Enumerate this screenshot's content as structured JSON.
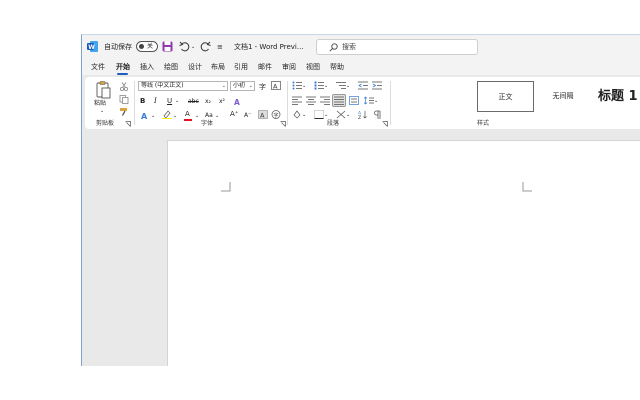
{
  "titlebar": {
    "autosave_label": "自动保存",
    "autosave_state": "关",
    "doc_title": "文档1 - Word Previ...",
    "qat_more": "≡"
  },
  "search": {
    "placeholder": "搜索"
  },
  "tabs": [
    {
      "label": "文件"
    },
    {
      "label": "开始"
    },
    {
      "label": "插入"
    },
    {
      "label": "绘图"
    },
    {
      "label": "设计"
    },
    {
      "label": "布局"
    },
    {
      "label": "引用"
    },
    {
      "label": "邮件"
    },
    {
      "label": "审阅"
    },
    {
      "label": "视图"
    },
    {
      "label": "帮助"
    }
  ],
  "active_tab": "开始",
  "ribbon": {
    "clipboard": {
      "paste_label": "粘贴",
      "group_label": "剪贴板"
    },
    "font": {
      "font_name": "等线 (中文正文)",
      "font_size": "小初",
      "bold": "B",
      "italic": "I",
      "underline": "U",
      "strike": "abc",
      "subscript": "x₂",
      "superscript": "x²",
      "font_color_letter": "A",
      "grow": "A⁺",
      "shrink": "A⁻",
      "change_case": "Aa",
      "clear_format": "A",
      "group_label": "字体"
    },
    "paragraph": {
      "group_label": "段落"
    },
    "styles": {
      "items": [
        {
          "label": "正文"
        },
        {
          "label": "无间隔"
        },
        {
          "label": "标题 1"
        }
      ],
      "group_label": "样式"
    }
  },
  "colors": {
    "accent": "#1f5fbf",
    "font_color_bar": "#e81123",
    "highlight_bar": "#fff100",
    "word_icon": "#185abd"
  }
}
